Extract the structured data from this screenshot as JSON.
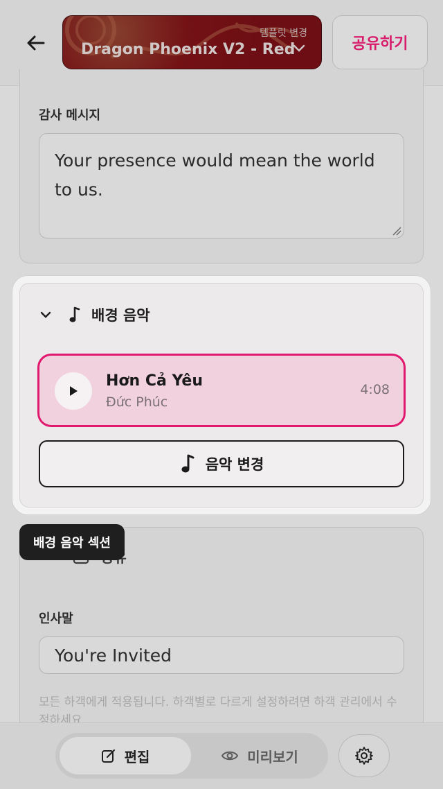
{
  "header": {
    "template_hint": "템플릿 변경",
    "template_name": "Dragon Phoenix V2 - Red",
    "share_label": "공유하기"
  },
  "thanks": {
    "label": "감사 메시지",
    "message": "Your presence would mean the world to us."
  },
  "music": {
    "section_title": "배경 음악",
    "track": {
      "title": "Hơn Cả Yêu",
      "artist": "Đức Phúc",
      "duration": "4:08"
    },
    "change_label": "음악 변경"
  },
  "tooltip": "배경 음악 섹션",
  "common": {
    "label": "공유"
  },
  "greeting": {
    "label": "인사말",
    "value": "You're Invited",
    "hint": "모든 하객에게 적용됩니다. 하객별로 다르게 설정하려면 하객 관리에서 수정하세요."
  },
  "bottom": {
    "edit_label": "편집",
    "preview_label": "미리보기"
  },
  "colors": {
    "accent": "#e0196e",
    "track_bg": "#f1d1de",
    "template_bg": "#6b0f14"
  }
}
